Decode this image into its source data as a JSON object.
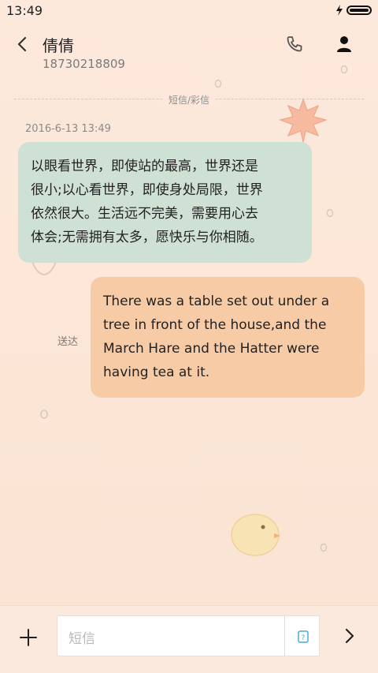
{
  "status_bar": {
    "time": "13:49",
    "icons": [
      "charging-icon",
      "battery-icon"
    ]
  },
  "header": {
    "contact_name": "倩倩",
    "contact_number": "18730218809",
    "icons": [
      "back-chevron-icon",
      "phone-icon",
      "contact-icon"
    ]
  },
  "channel_label": "短信/彩信",
  "messages": [
    {
      "direction": "incoming",
      "timestamp": "2016-6-13 13:49",
      "lines": [
        "以眼看世界，即使站的最高，世界还是",
        "很小;以心看世界，即使身处局限，世界",
        "依然很大。生活远不完美，需要用心去",
        "体会;无需拥有太多，愿快乐与你相随。"
      ]
    },
    {
      "direction": "outgoing",
      "status": "送达",
      "lines": [
        "There was a table set out under a",
        "tree in front of the house,and the",
        "March Hare and the Hatter were",
        "having tea at it."
      ]
    }
  ],
  "compose": {
    "placeholder": "短信",
    "icons": [
      "add-icon",
      "attachment-icon",
      "send-icon"
    ]
  },
  "colors": {
    "background": "#fbe6d6",
    "incoming_bubble": "#cfe0d4",
    "outgoing_bubble": "#f8cba7"
  }
}
